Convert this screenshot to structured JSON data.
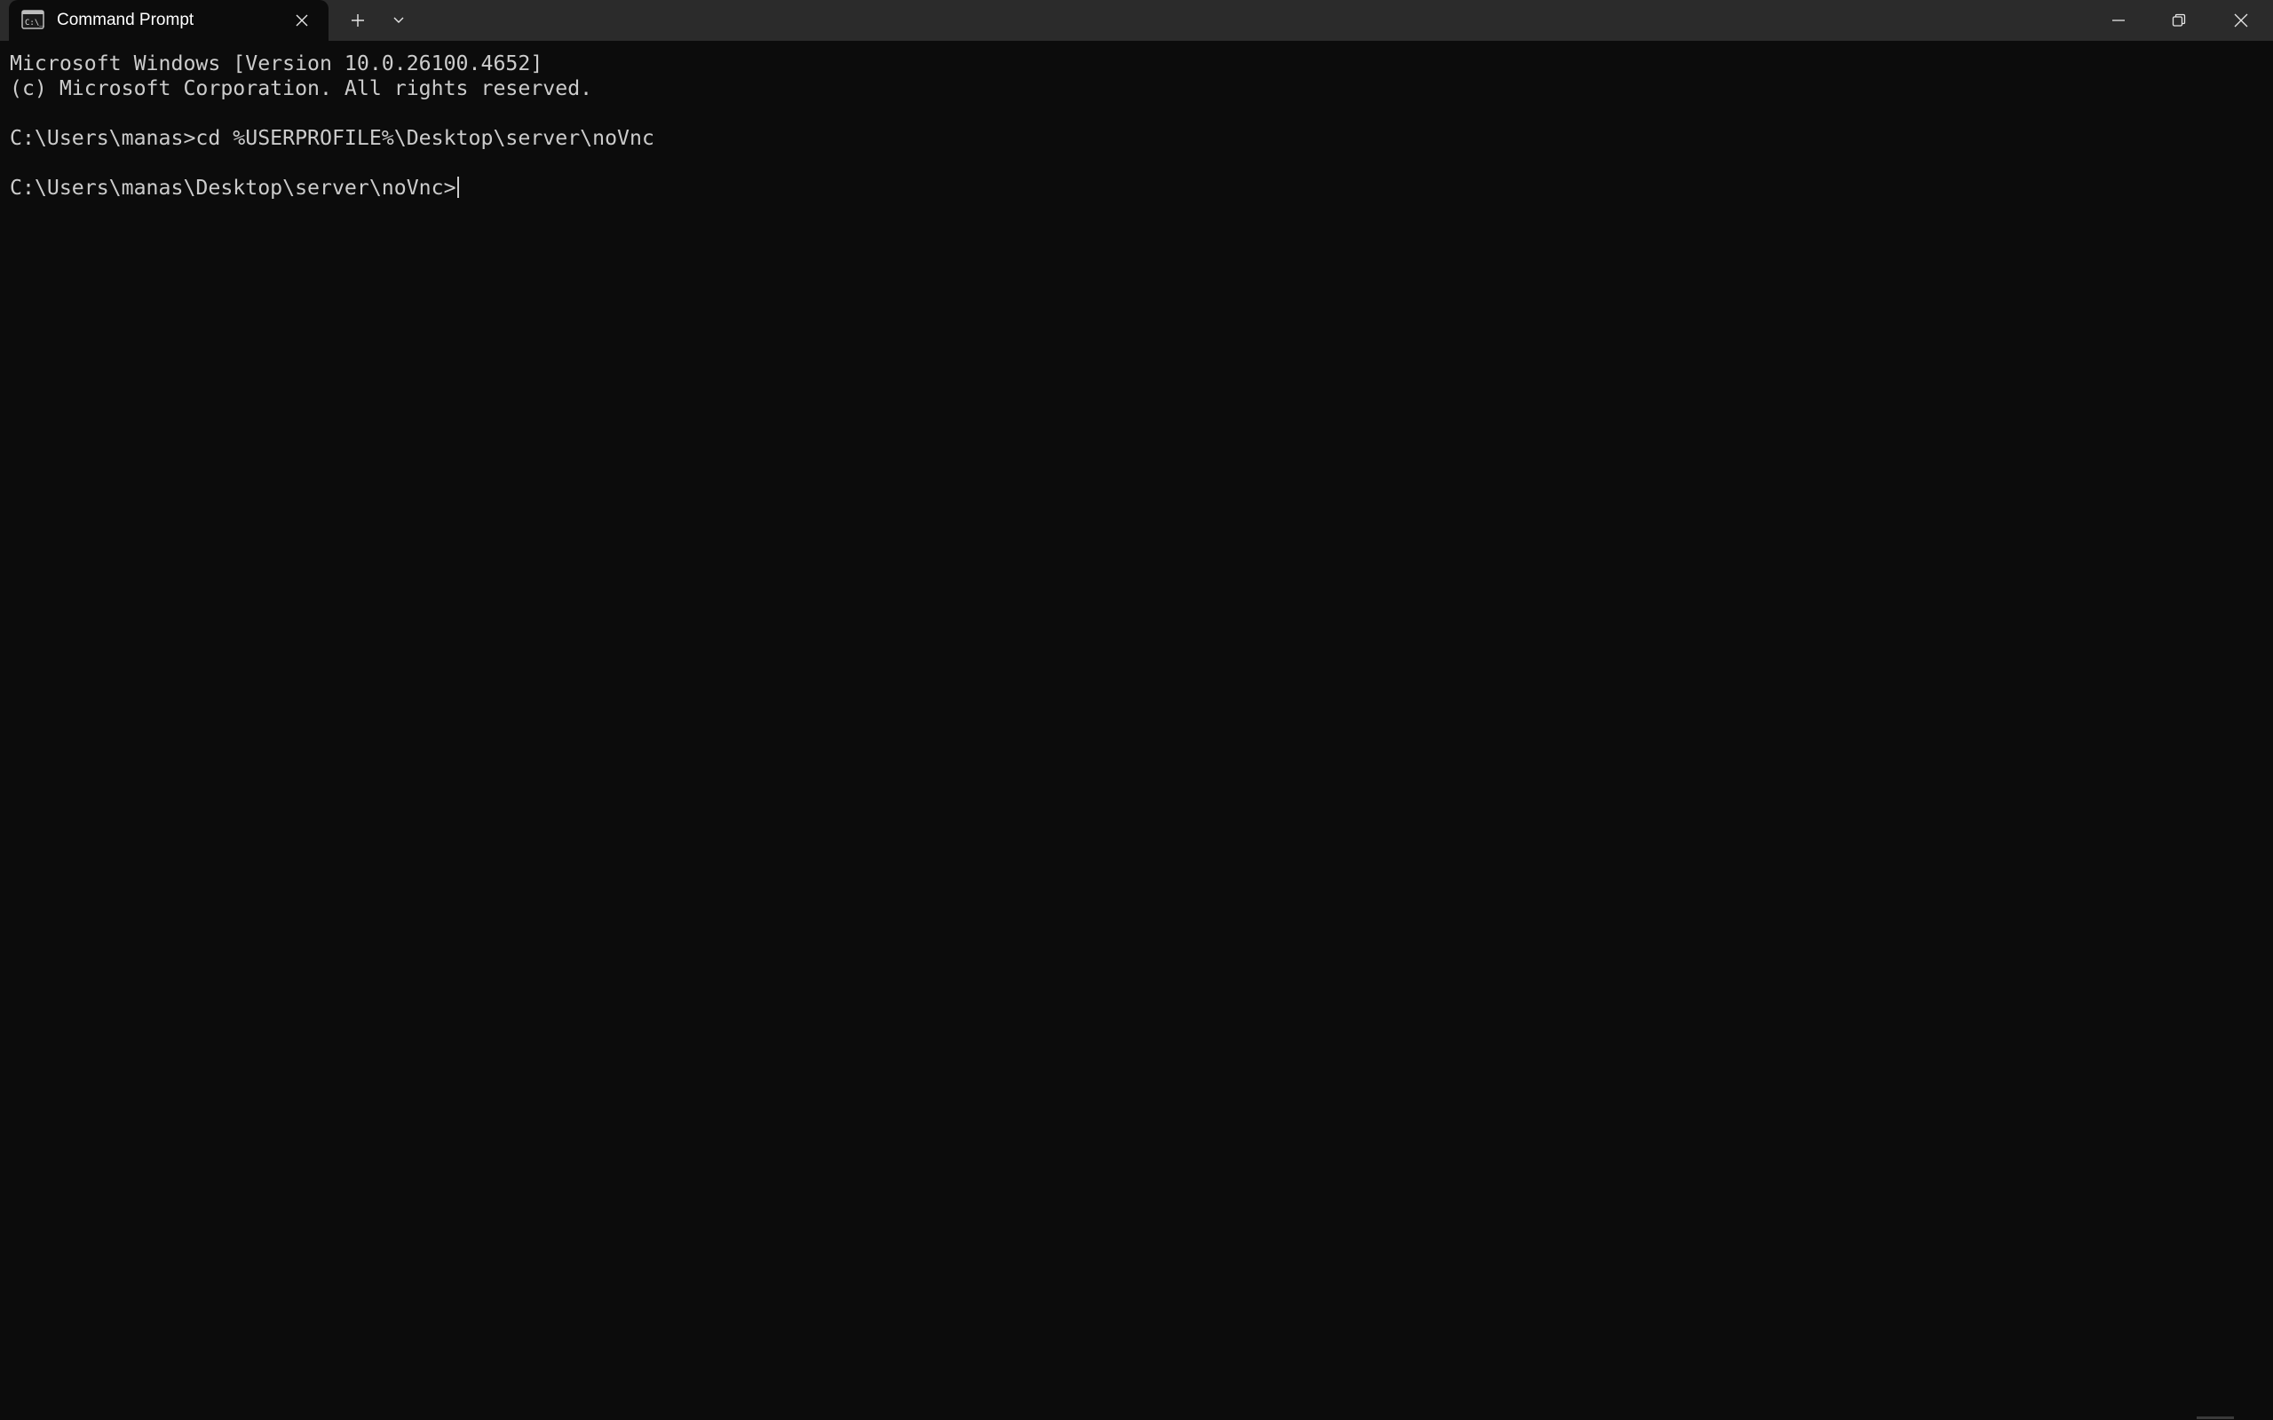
{
  "tab": {
    "title": "Command Prompt",
    "icon": "cmd-icon"
  },
  "toolbar": {
    "new_tab_icon": "plus-icon",
    "dropdown_icon": "chevron-down-icon"
  },
  "window_controls": {
    "minimize_icon": "minimize-icon",
    "restore_icon": "restore-icon",
    "close_icon": "close-icon"
  },
  "terminal": {
    "lines": [
      "Microsoft Windows [Version 10.0.26100.4652]",
      "(c) Microsoft Corporation. All rights reserved.",
      "",
      "C:\\Users\\manas>cd %USERPROFILE%\\Desktop\\server\\noVnc",
      "",
      "C:\\Users\\manas\\Desktop\\server\\noVnc>"
    ]
  },
  "colors": {
    "background": "#0c0c0c",
    "titlebar": "#2b2b2b",
    "text": "#cccccc"
  }
}
